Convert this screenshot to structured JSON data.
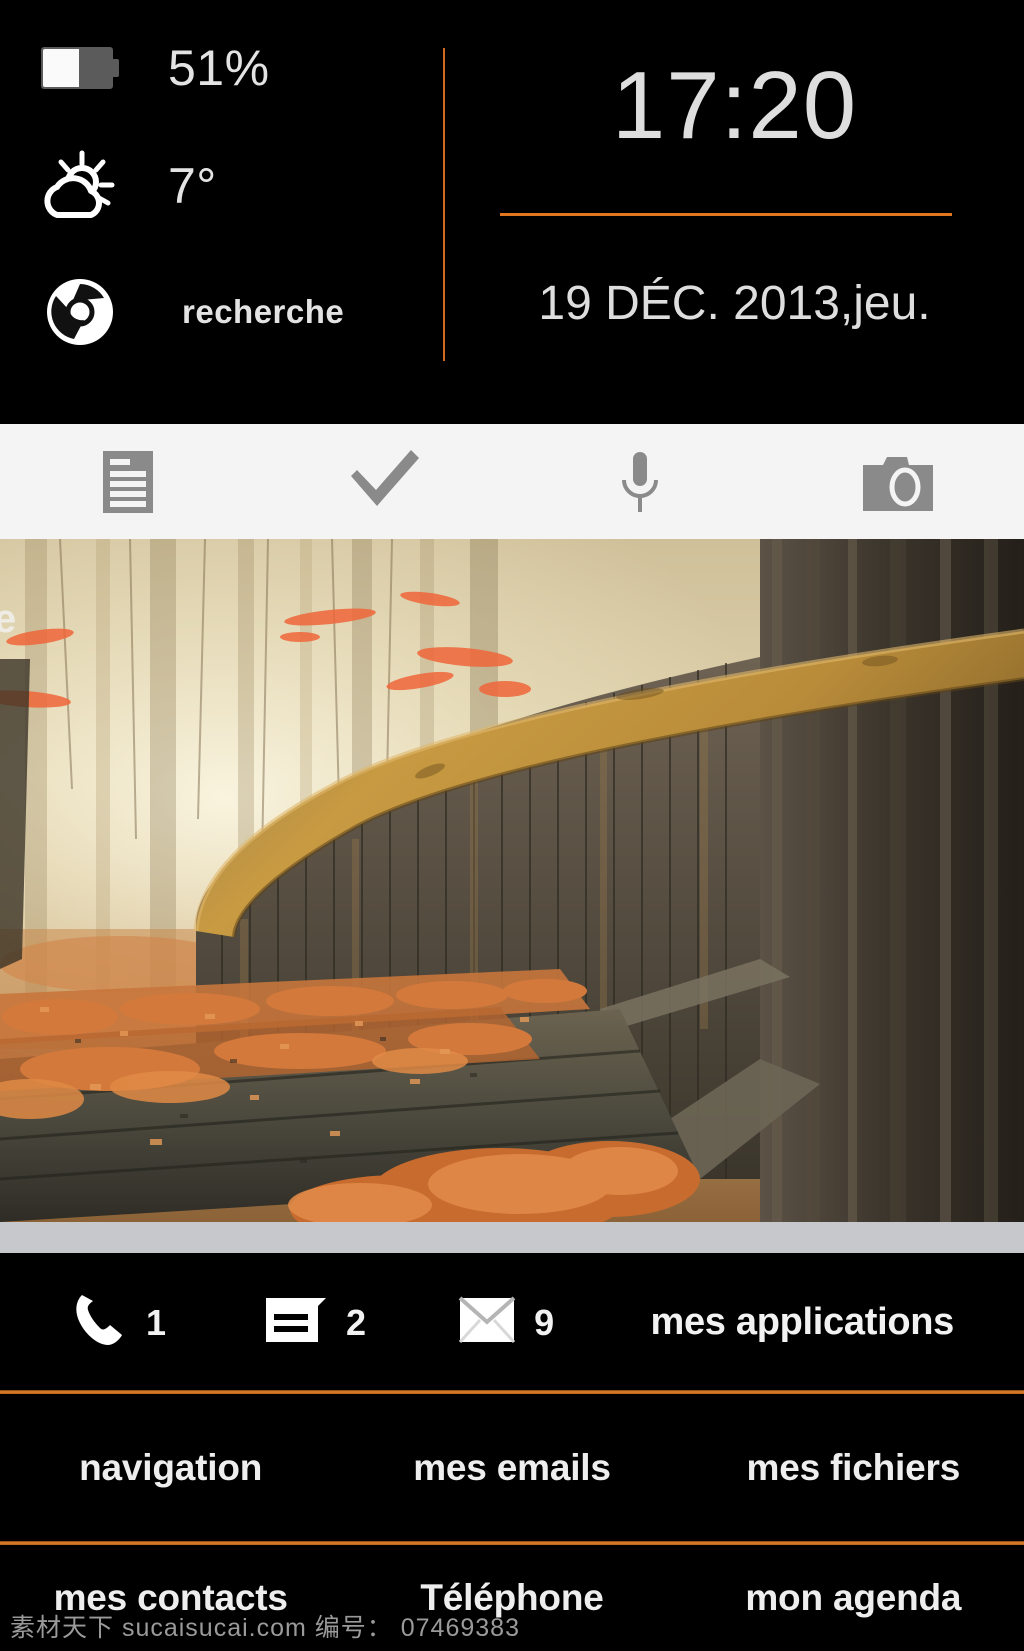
{
  "status_panel": {
    "battery": {
      "icon": "battery-icon",
      "value": "51%",
      "level_percent": 51
    },
    "weather": {
      "icon": "partly-cloudy-icon",
      "value": "7°"
    },
    "search": {
      "icon": "chrome-icon",
      "label": "recherche"
    },
    "clock": {
      "time": "17:20",
      "date": "19 DÉC. 2013,jeu."
    }
  },
  "toolbar": {
    "items": [
      {
        "icon": "list-view-icon",
        "name": "list-button"
      },
      {
        "icon": "checkmark-icon",
        "name": "check-button"
      },
      {
        "icon": "microphone-icon",
        "name": "voice-button"
      },
      {
        "icon": "camera-icon",
        "name": "camera-button"
      }
    ]
  },
  "wallpaper": {
    "description": "autumn forest footbridge",
    "stray_text": "e"
  },
  "dock": {
    "phone": {
      "icon": "phone-icon",
      "count": "1"
    },
    "messages": {
      "icon": "message-icon",
      "count": "2"
    },
    "email": {
      "icon": "envelope-icon",
      "count": "9"
    },
    "apps_label": "mes applications"
  },
  "menu": {
    "row1": [
      "navigation",
      "mes emails",
      "mes fichiers"
    ],
    "row2": [
      "mes contacts",
      "Téléphone",
      "mon agenda"
    ]
  },
  "watermark": "素材天下 sucaisucai.com 编号： 07469383",
  "colors": {
    "accent_orange": "#e0761f",
    "panel_black": "#000000",
    "toolbar_bg": "#f4f4f4",
    "strip_gray": "#c6c8cb",
    "text_light": "#dedede"
  }
}
